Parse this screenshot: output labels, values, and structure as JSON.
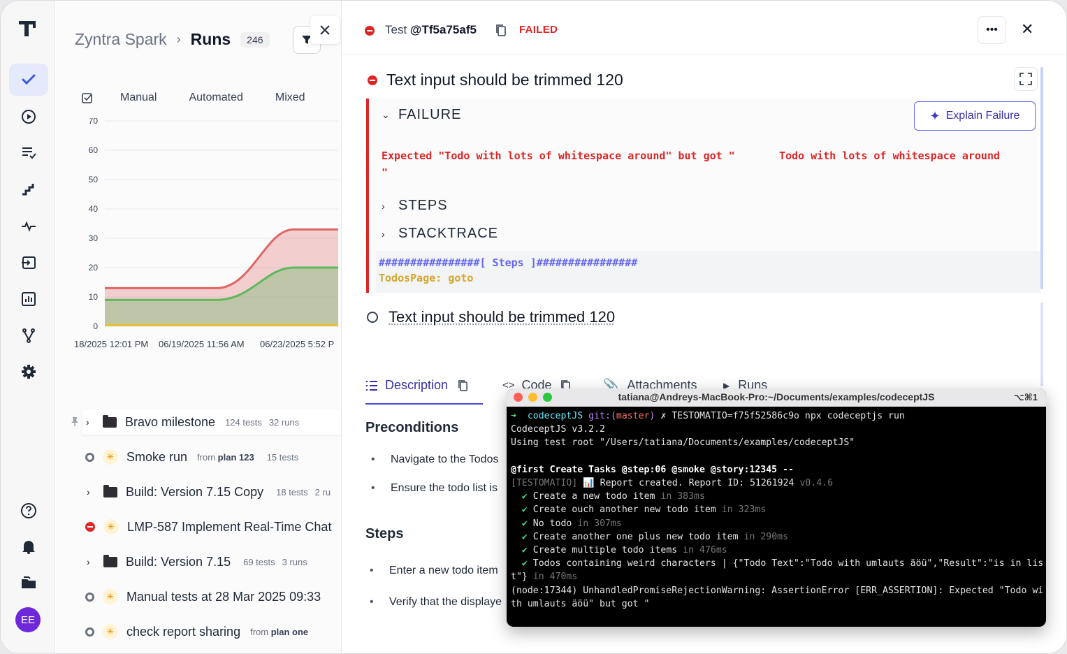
{
  "runs_panel": {
    "project": "Zyntra Spark",
    "section": "Runs",
    "count": "246",
    "tabs": [
      "Manual",
      "Automated",
      "Mixed"
    ]
  },
  "chart_data": {
    "type": "area",
    "x": [
      "18/2025 12:01 PM",
      "06/19/2025 11:56 AM",
      "06/23/2025 5:52 P"
    ],
    "y_ticks": [
      "70",
      "60",
      "50",
      "40",
      "30",
      "20",
      "10",
      "0"
    ],
    "ylim": [
      0,
      70
    ],
    "series": [
      {
        "color": "#e06666",
        "values": [
          13,
          13,
          13,
          33
        ]
      },
      {
        "color": "#5cb85c",
        "values": [
          9,
          9,
          9,
          20
        ]
      },
      {
        "color": "#e5c13a",
        "values": [
          0.5,
          0.5,
          0.5,
          0.5
        ]
      }
    ],
    "grid": true
  },
  "run_list": [
    {
      "kind": "folder",
      "label": "Bravo milestone",
      "meta1": "124 tests",
      "meta2": "32 runs"
    },
    {
      "kind": "run",
      "status": "grey",
      "label": "Smoke run",
      "from": "from",
      "plan": "plan 123",
      "meta1": "15 tests"
    },
    {
      "kind": "folder",
      "label": "Build: Version 7.15 Copy",
      "meta1": "18 tests",
      "meta2": "2 ru"
    },
    {
      "kind": "run",
      "status": "red",
      "label": "LMP-587 Implement Real-Time Chat"
    },
    {
      "kind": "folder",
      "label": "Build: Version 7.15",
      "meta1": "69 tests",
      "meta2": "3 runs"
    },
    {
      "kind": "run",
      "status": "grey",
      "label": "Manual tests at 28 Mar 2025 09:33"
    },
    {
      "kind": "run",
      "status": "grey",
      "label": "check report sharing",
      "from": "from",
      "plan": "plan one"
    }
  ],
  "detail": {
    "test_prefix": "Test",
    "test_id": "@Tf5a75af5",
    "status": "FAILED",
    "test1_title": "Text input should be trimmed 120",
    "failure_label": "FAILURE",
    "explain_label": "Explain Failure",
    "error_line1": "Expected \"Todo with lots of whitespace around\" but got \"       Todo with lots of whitespace around",
    "error_line2": "\"",
    "steps_label": "STEPS",
    "stacktrace_label": "STACKTRACE",
    "steps_code_l1": "################[ Steps ]################",
    "steps_code_l2": "TodosPage: goto",
    "test2_title": "Text input should be trimmed 120",
    "tabs": [
      "Description",
      "Code",
      "Attachments",
      "Runs"
    ],
    "preconditions": "Preconditions",
    "pre_items": [
      "Navigate to the Todos",
      "Ensure the todo list is"
    ],
    "steps": "Steps",
    "step_items": [
      "Enter a new todo item",
      "Verify that the displaye"
    ]
  },
  "terminal": {
    "title": "tatiana@Andreys-MacBook-Pro:~/Documents/examples/codeceptJS",
    "shortcut": "⌥⌘1",
    "prompt_arrow": "➜",
    "prompt_dir": "codeceptJS",
    "prompt_git": "git:(",
    "prompt_branch": "master",
    "prompt_git_end": ")",
    "prompt_x": "✗",
    "cmd": "TESTOMATIO=f75f52586c9o npx codeceptjs run",
    "lines": [
      "CodeceptJS v3.2.2",
      "Using test root \"/Users/tatiana/Documents/examples/codeceptJS\""
    ],
    "suite": "@first Create Tasks @step:06 @smoke @story:12345 --",
    "report_tag": "[TESTOMATIO]",
    "report_icon": "📊",
    "report": "Report created. Report ID: 51261924",
    "report_ver": "v0.4.6",
    "tests": [
      {
        "name": "Create a new todo item",
        "time": "in 383ms"
      },
      {
        "name": "Create ouch another new todo item",
        "time": "in 323ms"
      },
      {
        "name": "No todo",
        "time": "in 307ms"
      },
      {
        "name": "Create another one plus new todo item",
        "time": "in 290ms"
      },
      {
        "name": "Create multiple todo items",
        "time": "in 476ms"
      },
      {
        "name": "Todos containing weird characters | {\"Todo Text\":\"Todo with umlauts äöü\",\"Result\":\"is in lis",
        "time": ""
      }
    ],
    "wrap1": "t\"}",
    "wrap1_time": "in 470ms",
    "warn1": "(node:17344) UnhandledPromiseRejectionWarning: AssertionError [ERR_ASSERTION]: Expected \"Todo wi",
    "warn2": "th umlauts äöü\" but got \""
  },
  "user": {
    "initials": "EE"
  }
}
